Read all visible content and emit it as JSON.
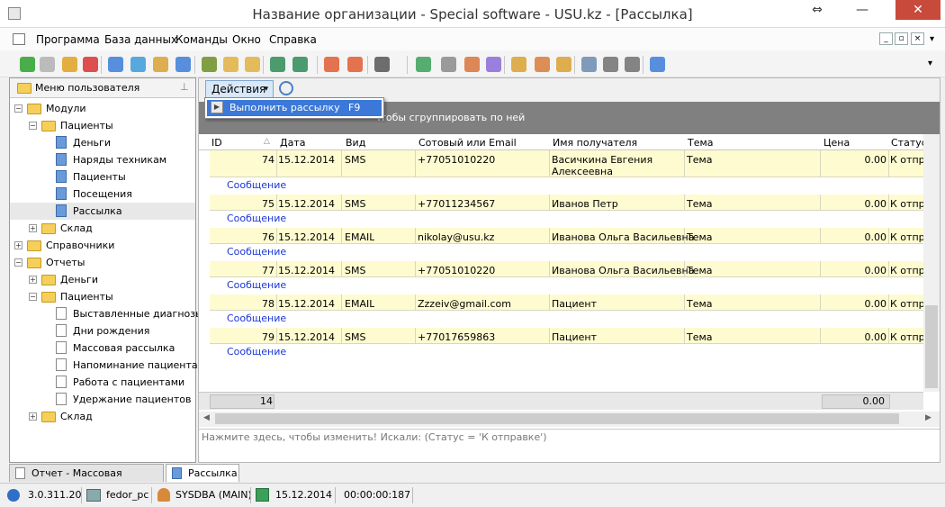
{
  "window": {
    "title": "Название организации - Special software - USU.kz - [Рассылка]",
    "restore_glyph": "⇔",
    "minimize_glyph": "—",
    "close_glyph": "✕"
  },
  "menubar": {
    "items": [
      "Программа",
      "База данных",
      "Команды",
      "Окно",
      "Справка"
    ],
    "mdi": {
      "minimize": "_",
      "restore": "▫",
      "close": "×"
    },
    "chevron": "▾"
  },
  "toolbar": {
    "icons": [
      {
        "name": "add-icon",
        "color": "#2aa12a"
      },
      {
        "name": "copy-icon",
        "color": "#b0b0b0"
      },
      {
        "name": "edit-icon",
        "color": "#e0a020"
      },
      {
        "name": "delete-icon",
        "color": "#d93030"
      },
      {
        "name": "search-icon",
        "color": "#3b7dd8"
      },
      {
        "name": "refresh-icon",
        "color": "#3b9ad8"
      },
      {
        "name": "sort-icon",
        "color": "#d8a030"
      },
      {
        "name": "comment-icon",
        "color": "#3b7dd8"
      },
      {
        "name": "filter-icon",
        "color": "#6b8e23"
      },
      {
        "name": "group-icon",
        "color": "#e0b040"
      },
      {
        "name": "tree-icon",
        "color": "#e0b040"
      },
      {
        "name": "export-excel-icon",
        "color": "#2e8b57"
      },
      {
        "name": "export-menu-icon",
        "color": "#2e8b57"
      },
      {
        "name": "new-window-icon",
        "color": "#e05a30"
      },
      {
        "name": "close-window-icon",
        "color": "#e05a30"
      },
      {
        "name": "print-preview-icon",
        "color": "#555555"
      },
      {
        "name": "calendar-icon",
        "color": "#3aa05a"
      },
      {
        "name": "tools-icon",
        "color": "#8a8a8a"
      },
      {
        "name": "palette-icon",
        "color": "#d8733a"
      },
      {
        "name": "notepad-icon",
        "color": "#8a6ad8"
      },
      {
        "name": "lock-icon",
        "color": "#d8a030"
      },
      {
        "name": "users-icon",
        "color": "#d87a3a"
      },
      {
        "name": "key-icon",
        "color": "#d8a030"
      },
      {
        "name": "table-icon",
        "color": "#6a8ab0"
      },
      {
        "name": "printer-icon",
        "color": "#707070"
      },
      {
        "name": "play-icon",
        "color": "#707070"
      },
      {
        "name": "info-icon",
        "color": "#3b7dd8"
      }
    ],
    "chevron": "▾"
  },
  "left_panel": {
    "header": "Меню пользователя",
    "pin_glyph": "⊥",
    "tree": [
      {
        "label": "Модули",
        "depth": 0,
        "expander": "−",
        "kind": "folder",
        "selected": false
      },
      {
        "label": "Пациенты",
        "depth": 1,
        "expander": "−",
        "kind": "folder",
        "selected": false
      },
      {
        "label": "Деньги",
        "depth": 2,
        "expander": "",
        "kind": "form",
        "selected": false
      },
      {
        "label": "Наряды техникам",
        "depth": 2,
        "expander": "",
        "kind": "form",
        "selected": false
      },
      {
        "label": "Пациенты",
        "depth": 2,
        "expander": "",
        "kind": "form",
        "selected": false
      },
      {
        "label": "Посещения",
        "depth": 2,
        "expander": "",
        "kind": "form",
        "selected": false
      },
      {
        "label": "Рассылка",
        "depth": 2,
        "expander": "",
        "kind": "form",
        "selected": true
      },
      {
        "label": "Склад",
        "depth": 1,
        "expander": "+",
        "kind": "folder",
        "selected": false
      },
      {
        "label": "Справочники",
        "depth": 0,
        "expander": "+",
        "kind": "folder",
        "selected": false
      },
      {
        "label": "Отчеты",
        "depth": 0,
        "expander": "−",
        "kind": "folder",
        "selected": false
      },
      {
        "label": "Деньги",
        "depth": 1,
        "expander": "+",
        "kind": "folder",
        "selected": false
      },
      {
        "label": "Пациенты",
        "depth": 1,
        "expander": "−",
        "kind": "folder",
        "selected": false
      },
      {
        "label": "Выставленные диагнозы",
        "depth": 2,
        "expander": "",
        "kind": "doc",
        "selected": false
      },
      {
        "label": "Дни рождения",
        "depth": 2,
        "expander": "",
        "kind": "doc",
        "selected": false
      },
      {
        "label": "Массовая рассылка",
        "depth": 2,
        "expander": "",
        "kind": "doc",
        "selected": false
      },
      {
        "label": "Напоминание пациентам",
        "depth": 2,
        "expander": "",
        "kind": "doc",
        "selected": false
      },
      {
        "label": "Работа с пациентами",
        "depth": 2,
        "expander": "",
        "kind": "doc",
        "selected": false
      },
      {
        "label": "Удержание пациентов",
        "depth": 2,
        "expander": "",
        "kind": "doc",
        "selected": false
      },
      {
        "label": "Склад",
        "depth": 1,
        "expander": "+",
        "kind": "folder",
        "selected": false
      }
    ]
  },
  "actions": {
    "label": "Действия",
    "chevron": "▾",
    "menu_item": "Выполнить рассылку",
    "menu_shortcut": "F9",
    "play_glyph": "▶"
  },
  "group_panel": {
    "hint": "чтобы сгруппировать по ней"
  },
  "grid": {
    "columns": [
      "ID",
      "Дата",
      "Вид",
      "Сотовый или Email",
      "Имя получателя",
      "Тема",
      "Цена",
      "Статус"
    ],
    "sort_glyph": "△",
    "detail_label": "Сообщение",
    "rows": [
      {
        "id": "74",
        "date": "15.12.2014",
        "kind": "SMS",
        "contact": "+77051010220",
        "name": "Васичкина Евгения",
        "name2": "Алексеевна",
        "subject": "Тема",
        "price": "0.00",
        "status": "К отправке"
      },
      {
        "id": "75",
        "date": "15.12.2014",
        "kind": "SMS",
        "contact": "+77011234567",
        "name": "Иванов Петр",
        "name2": "",
        "subject": "Тема",
        "price": "0.00",
        "status": "К отправке"
      },
      {
        "id": "76",
        "date": "15.12.2014",
        "kind": "EMAIL",
        "contact": "nikolay@usu.kz",
        "name": "Иванова Ольга Васильевна",
        "name2": "",
        "subject": "Тема",
        "price": "0.00",
        "status": "К отправке"
      },
      {
        "id": "77",
        "date": "15.12.2014",
        "kind": "SMS",
        "contact": "+77051010220",
        "name": "Иванова Ольга Васильевна",
        "name2": "",
        "subject": "Тема",
        "price": "0.00",
        "status": "К отправке"
      },
      {
        "id": "78",
        "date": "15.12.2014",
        "kind": "EMAIL",
        "contact": "Zzzeiv@gmail.com",
        "name": "Пациент",
        "name2": "",
        "subject": "Тема",
        "price": "0.00",
        "status": "К отправке"
      },
      {
        "id": "79",
        "date": "15.12.2014",
        "kind": "SMS",
        "contact": "+77017659863",
        "name": "Пациент",
        "name2": "",
        "subject": "Тема",
        "price": "0.00",
        "status": "К отправке"
      }
    ],
    "footer": {
      "count": "14",
      "total": "0.00"
    }
  },
  "filter": {
    "text": "Нажмите здесь, чтобы изменить! Искали: (Статус = 'К отправке')"
  },
  "tabs": [
    {
      "label": "Отчет - Массовая рассылка",
      "active": false
    },
    {
      "label": "Рассылка",
      "active": true
    }
  ],
  "statusbar": {
    "version": "3.0.311.20",
    "computer": "fedor_pc",
    "user": "SYSDBA (MAIN)",
    "date": "15.12.2014",
    "timer": "00:00:00:187"
  },
  "colors": {
    "row_bg": "#fefbd0",
    "detail_link": "#1a37d6",
    "group_panel": "#808080"
  }
}
